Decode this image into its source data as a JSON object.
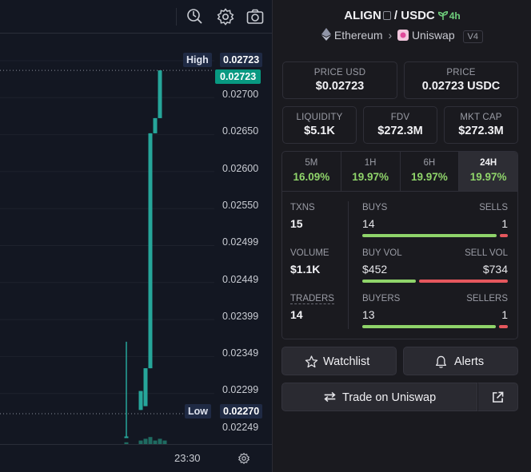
{
  "chart": {
    "high_tag": "High",
    "high_value": "0.02723",
    "last_price_tag": "0.02723",
    "low_tag": "Low",
    "low_value": "0.02270",
    "price_labels": [
      "0.02700",
      "0.02650",
      "0.02600",
      "0.02550",
      "0.02499",
      "0.02449",
      "0.02399",
      "0.02349",
      "0.02299",
      "0.02249"
    ],
    "time_label": "23:30",
    "colors": {
      "up": "#26a69a",
      "background": "#131722",
      "grid": "#1e222d",
      "tag": "#1f2a44",
      "last": "#089981"
    }
  },
  "chart_data": {
    "type": "candlestick",
    "ylim": [
      0.0223,
      0.0276
    ],
    "candles": [
      {
        "open": 0.0224,
        "high": 0.02365,
        "low": 0.0224,
        "close": 0.0224
      },
      {
        "open": 0.02275,
        "high": 0.023,
        "low": 0.02275,
        "close": 0.023
      },
      {
        "open": 0.0228,
        "high": 0.0233,
        "low": 0.0228,
        "close": 0.0233
      },
      {
        "open": 0.0233,
        "high": 0.0264,
        "low": 0.0233,
        "close": 0.0264
      },
      {
        "open": 0.0264,
        "high": 0.0266,
        "low": 0.0264,
        "close": 0.0266
      },
      {
        "open": 0.0266,
        "high": 0.02723,
        "low": 0.0266,
        "close": 0.02723
      }
    ],
    "volume": [
      1,
      2,
      3,
      4,
      2,
      3,
      2
    ]
  },
  "pair": {
    "base": "ALIGN",
    "quote": "USDC",
    "age": "4h",
    "chain": "Ethereum",
    "dex": "Uniswap",
    "dex_version": "V4"
  },
  "stats": {
    "price_usd_label": "PRICE USD",
    "price_usd": "$0.02723",
    "price_label": "PRICE",
    "price": "0.02723 USDC",
    "liquidity_label": "LIQUIDITY",
    "liquidity": "$5.1K",
    "fdv_label": "FDV",
    "fdv": "$272.3M",
    "mkt_cap_label": "MKT CAP",
    "mkt_cap": "$272.3M"
  },
  "timeframes": [
    {
      "label": "5M",
      "change": "16.09%"
    },
    {
      "label": "1H",
      "change": "19.97%"
    },
    {
      "label": "6H",
      "change": "19.97%"
    },
    {
      "label": "24H",
      "change": "19.97%"
    }
  ],
  "activity": {
    "txns_label": "TXNS",
    "txns": "15",
    "buys_label": "BUYS",
    "buys": "14",
    "sells_label": "SELLS",
    "sells": "1",
    "buys_fraction": 0.933,
    "volume_label": "VOLUME",
    "volume": "$1.1K",
    "buy_vol_label": "BUY VOL",
    "buy_vol": "$452",
    "sell_vol_label": "SELL VOL",
    "sell_vol": "$734",
    "buy_vol_fraction": 0.381,
    "traders_label": "TRADERS",
    "traders": "14",
    "buyers_label": "BUYERS",
    "buyers": "13",
    "sellers_label": "SELLERS",
    "sellers": "1",
    "buyers_fraction": 0.929
  },
  "actions": {
    "watchlist": "Watchlist",
    "alerts": "Alerts",
    "trade": "Trade on Uniswap"
  }
}
